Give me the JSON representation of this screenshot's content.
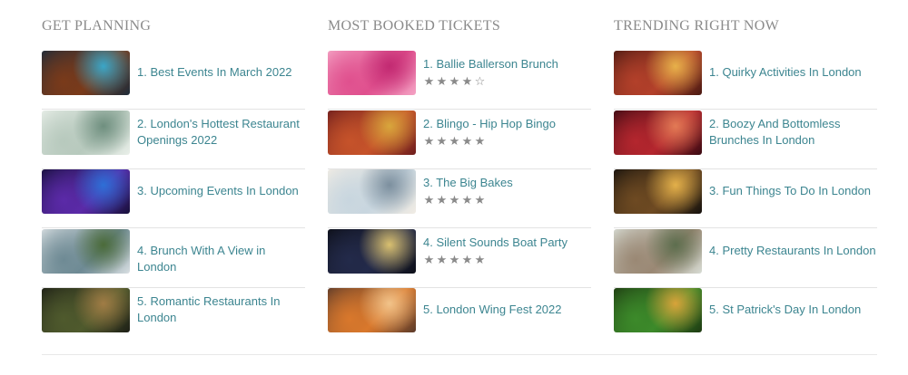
{
  "columns": [
    {
      "heading": "GET PLANNING",
      "items": [
        {
          "label": "1. Best Events In March 2022",
          "image": "stage-performance-image",
          "colors": [
            "#1d2c3a",
            "#7a3a1a",
            "#3aa6c8"
          ]
        },
        {
          "label": "2. London's Hottest Restaurant Openings 2022",
          "image": "bright-restaurant-interior-image",
          "colors": [
            "#e9efe9",
            "#b7c9bd",
            "#6f8f7f"
          ]
        },
        {
          "label": "3. Upcoming Events In London",
          "image": "concert-crowd-image",
          "colors": [
            "#16103a",
            "#5b2aa8",
            "#2d6fd6"
          ]
        },
        {
          "label": "4. Brunch With A View in London",
          "image": "skyline-restaurant-image",
          "colors": [
            "#d9dfe2",
            "#6e8a94",
            "#4b6b3a"
          ]
        },
        {
          "label": "5. Romantic Restaurants In London",
          "image": "garden-dining-image",
          "colors": [
            "#1d1f16",
            "#4f5a2d",
            "#a07c45"
          ]
        }
      ]
    },
    {
      "heading": "MOST BOOKED TICKETS",
      "items": [
        {
          "label": "1. Ballie Ballerson Brunch",
          "rating": 4,
          "image": "pink-ballpit-image",
          "colors": [
            "#f4a3c4",
            "#e0508e",
            "#c22a72"
          ]
        },
        {
          "label": "2. Blingo - Hip Hop Bingo",
          "rating": 5,
          "image": "hip-hop-bingo-image",
          "colors": [
            "#6e1d1d",
            "#c6532a",
            "#d8a63c"
          ]
        },
        {
          "label": "3. The Big Bakes",
          "rating": 5,
          "image": "baking-tent-image",
          "colors": [
            "#f1ece4",
            "#c8d6df",
            "#7c8f9e"
          ]
        },
        {
          "label": "4. Silent Sounds Boat Party",
          "rating": 5,
          "image": "night-river-boat-image",
          "colors": [
            "#0d0f18",
            "#232a4a",
            "#d9c070"
          ]
        },
        {
          "label": "5. London Wing Fest 2022",
          "rating": null,
          "image": "chicken-wings-image",
          "colors": [
            "#5b3a2a",
            "#d9782c",
            "#f1c38a"
          ]
        }
      ]
    },
    {
      "heading": "TRENDING RIGHT NOW",
      "items": [
        {
          "label": "1. Quirky Activities In London",
          "image": "arcade-bar-image",
          "colors": [
            "#4a1a12",
            "#b3402a",
            "#e7b14a"
          ]
        },
        {
          "label": "2. Boozy And Bottomless Brunches In London",
          "image": "party-brunch-image",
          "colors": [
            "#3a0a12",
            "#b4262e",
            "#e27a55"
          ]
        },
        {
          "label": "3. Fun Things To Do In London",
          "image": "night-market-image",
          "colors": [
            "#15110d",
            "#6e4a22",
            "#e3b04a"
          ]
        },
        {
          "label": "4. Pretty Restaurants In London",
          "image": "floral-restaurant-image",
          "colors": [
            "#d7dcd4",
            "#9a8874",
            "#5d6e4e"
          ]
        },
        {
          "label": "5. St Patrick's Day In London",
          "image": "st-patricks-image",
          "colors": [
            "#1e3a12",
            "#3c8a2a",
            "#d8a33a"
          ]
        }
      ]
    }
  ]
}
